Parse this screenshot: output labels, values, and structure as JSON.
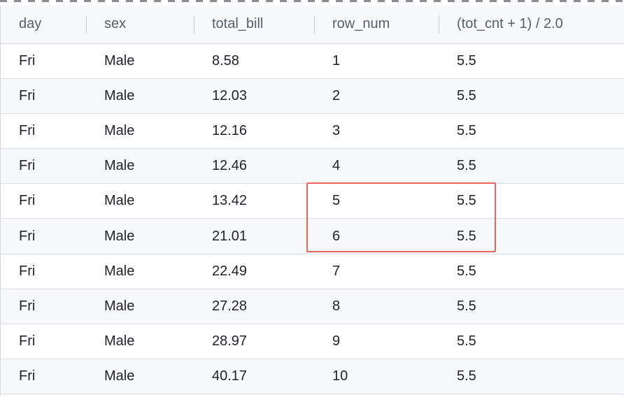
{
  "table": {
    "columns": [
      "day",
      "sex",
      "total_bill",
      "row_num",
      "(tot_cnt + 1) / 2.0"
    ],
    "rows": [
      [
        "Fri",
        "Male",
        "8.58",
        "1",
        "5.5"
      ],
      [
        "Fri",
        "Male",
        "12.03",
        "2",
        "5.5"
      ],
      [
        "Fri",
        "Male",
        "12.16",
        "3",
        "5.5"
      ],
      [
        "Fri",
        "Male",
        "12.46",
        "4",
        "5.5"
      ],
      [
        "Fri",
        "Male",
        "13.42",
        "5",
        "5.5"
      ],
      [
        "Fri",
        "Male",
        "21.01",
        "6",
        "5.5"
      ],
      [
        "Fri",
        "Male",
        "22.49",
        "7",
        "5.5"
      ],
      [
        "Fri",
        "Male",
        "27.28",
        "8",
        "5.5"
      ],
      [
        "Fri",
        "Male",
        "28.97",
        "9",
        "5.5"
      ],
      [
        "Fri",
        "Male",
        "40.17",
        "10",
        "5.5"
      ]
    ]
  },
  "highlight": {
    "color": "#e2675f",
    "rows": [
      5,
      6
    ],
    "columns": [
      "row_num",
      "(tot_cnt + 1) / 2.0"
    ]
  }
}
